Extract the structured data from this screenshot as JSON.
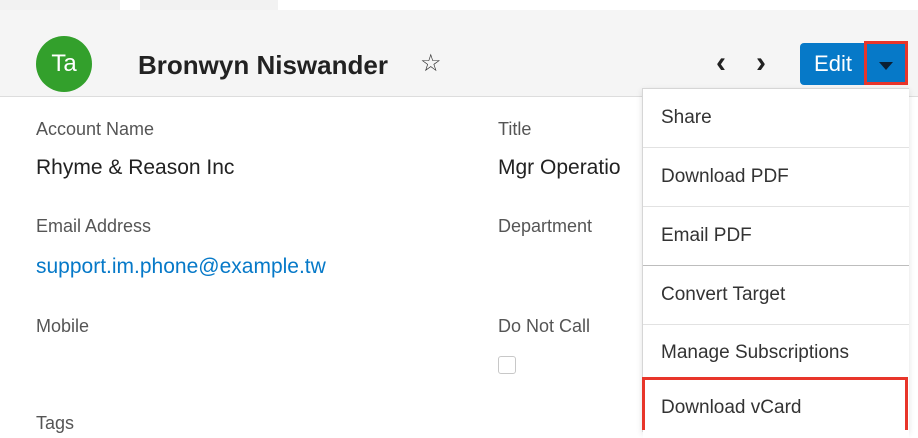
{
  "record": {
    "avatar_initials": "Ta",
    "name": "Bronwyn Niswander"
  },
  "header": {
    "favorite_icon": "star-outline-icon",
    "prev_glyph": "‹",
    "next_glyph": "›",
    "edit_label": "Edit"
  },
  "fields": {
    "account_name_label": "Account Name",
    "account_name_value": "Rhyme & Reason Inc",
    "title_label": "Title",
    "title_value": "Mgr Operatio",
    "email_label": "Email Address",
    "email_value": "support.im.phone@example.tw",
    "department_label": "Department",
    "mobile_label": "Mobile",
    "do_not_call_label": "Do Not Call",
    "tags_label": "Tags"
  },
  "menu": {
    "items": [
      "Share",
      "Download PDF",
      "Email PDF",
      "Convert Target",
      "Manage Subscriptions",
      "Download vCard"
    ]
  },
  "colors": {
    "primary": "#0679c8",
    "avatar": "#33a02c",
    "highlight": "#e8352a"
  }
}
